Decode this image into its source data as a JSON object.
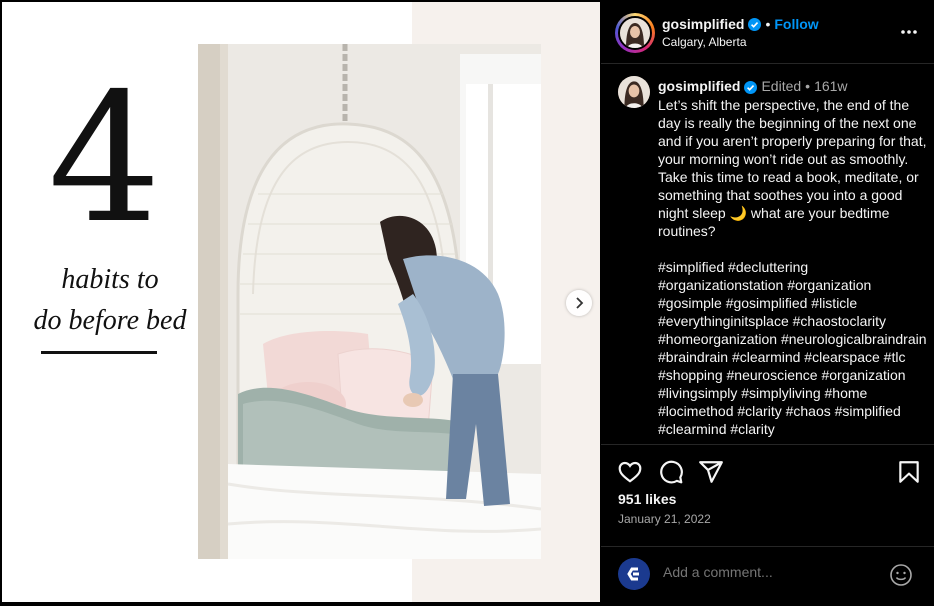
{
  "media": {
    "number": "4",
    "title_line1": "habits to",
    "title_line2": "do before bed"
  },
  "post": {
    "username": "gosimplified",
    "follow_label": "Follow",
    "location": "Calgary, Alberta",
    "edited_label": "Edited",
    "time_ago": "161w",
    "caption": "Let’s shift the perspective, the end of the day is really the beginning of the next one and if you aren’t properly preparing for that, your morning won’t ride out as smoothly. Take this time to read a book, meditate, or something that soothes you into a good night sleep 🌙 what are your bedtime routines?\n\n#simplified #decluttering #organizationstation #organization #gosimple #gosimplified #listicle #everythinginitsplace #chaostoclarity #homeorganization #neurologicalbraindrain #braindrain #clearmind #clearspace #tlc #shopping #neuroscience #organization #livingsimply #simplyliving #home #locimethod #clarity #chaos #simplified #clearmind #clarity",
    "likes": "951 likes",
    "date": "January 21, 2022",
    "comment_placeholder": "Add a comment..."
  },
  "colors": {
    "accent": "#0095f6",
    "panel_bg": "#000000",
    "secondary_text": "#a8a8a8"
  },
  "icons": [
    "verified-badge-icon",
    "more-options-icon",
    "heart-icon",
    "comment-icon",
    "share-icon",
    "bookmark-icon",
    "emoji-icon",
    "chevron-right-icon"
  ]
}
